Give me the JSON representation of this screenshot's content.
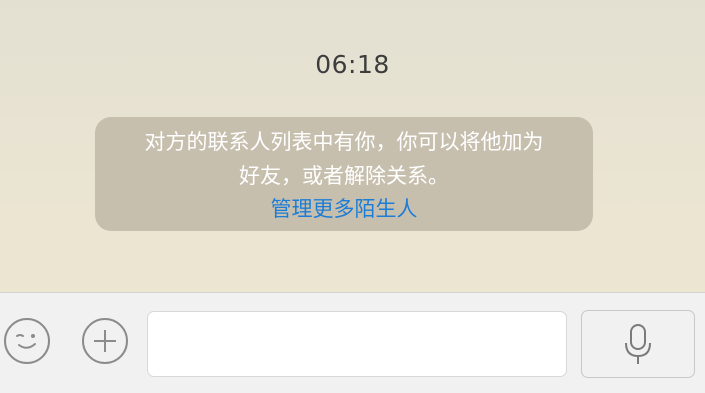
{
  "chat": {
    "timestamp": "06:18",
    "system_notice": {
      "line1": "对方的联系人列表中有你，你可以将他加为",
      "line2": "好友，或者解除关系。",
      "link": "管理更多陌生人"
    }
  },
  "input_bar": {
    "emoji_icon": "emoji-wink-icon",
    "plus_icon": "plus-circle-icon",
    "text_value": "",
    "mic_icon": "microphone-icon"
  },
  "colors": {
    "link": "#1d7dd6",
    "notice_bg": "#c7bfae"
  }
}
